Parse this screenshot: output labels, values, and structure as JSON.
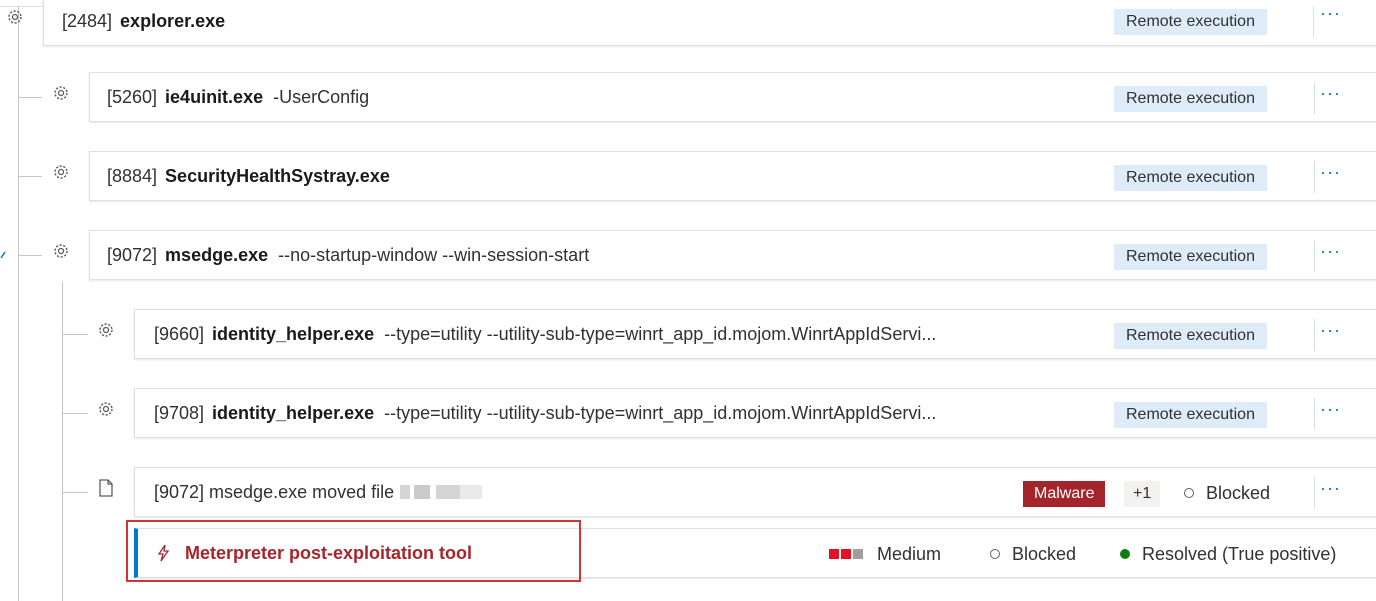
{
  "process_tree": [
    {
      "pid": "[2484]",
      "exe": "explorer.exe",
      "args": "",
      "action": "Remote execution",
      "more": "···"
    },
    {
      "pid": "[5260]",
      "exe": "ie4uinit.exe",
      "args": "-UserConfig",
      "action": "Remote execution",
      "more": "···"
    },
    {
      "pid": "[8884]",
      "exe": "SecurityHealthSystray.exe",
      "args": "",
      "action": "Remote execution",
      "more": "···"
    },
    {
      "pid": "[9072]",
      "exe": "msedge.exe",
      "args": "--no-startup-window --win-session-start",
      "action": "Remote execution",
      "more": "···"
    },
    {
      "pid": "[9660]",
      "exe": "identity_helper.exe",
      "args": "--type=utility --utility-sub-type=winrt_app_id.mojom.WinrtAppIdServi...",
      "action": "Remote execution",
      "more": "···"
    },
    {
      "pid": "[9708]",
      "exe": "identity_helper.exe",
      "args": "--type=utility --utility-sub-type=winrt_app_id.mojom.WinrtAppIdServi...",
      "action": "Remote execution",
      "more": "···"
    }
  ],
  "file_event": {
    "text": "[9072] msedge.exe moved file",
    "malware_label": "Malware",
    "extra_count": "+1",
    "status": "Blocked",
    "more": "···"
  },
  "alert": {
    "title": "Meterpreter post-exploitation tool",
    "severity": "Medium",
    "status": "Blocked",
    "resolution": "Resolved (True positive)"
  },
  "colors": {
    "accent": "#0078d4",
    "alert_red": "#a4262c",
    "badge_bg": "#deecf9",
    "severity_red": "#e81123",
    "resolved_green": "#107c10"
  }
}
